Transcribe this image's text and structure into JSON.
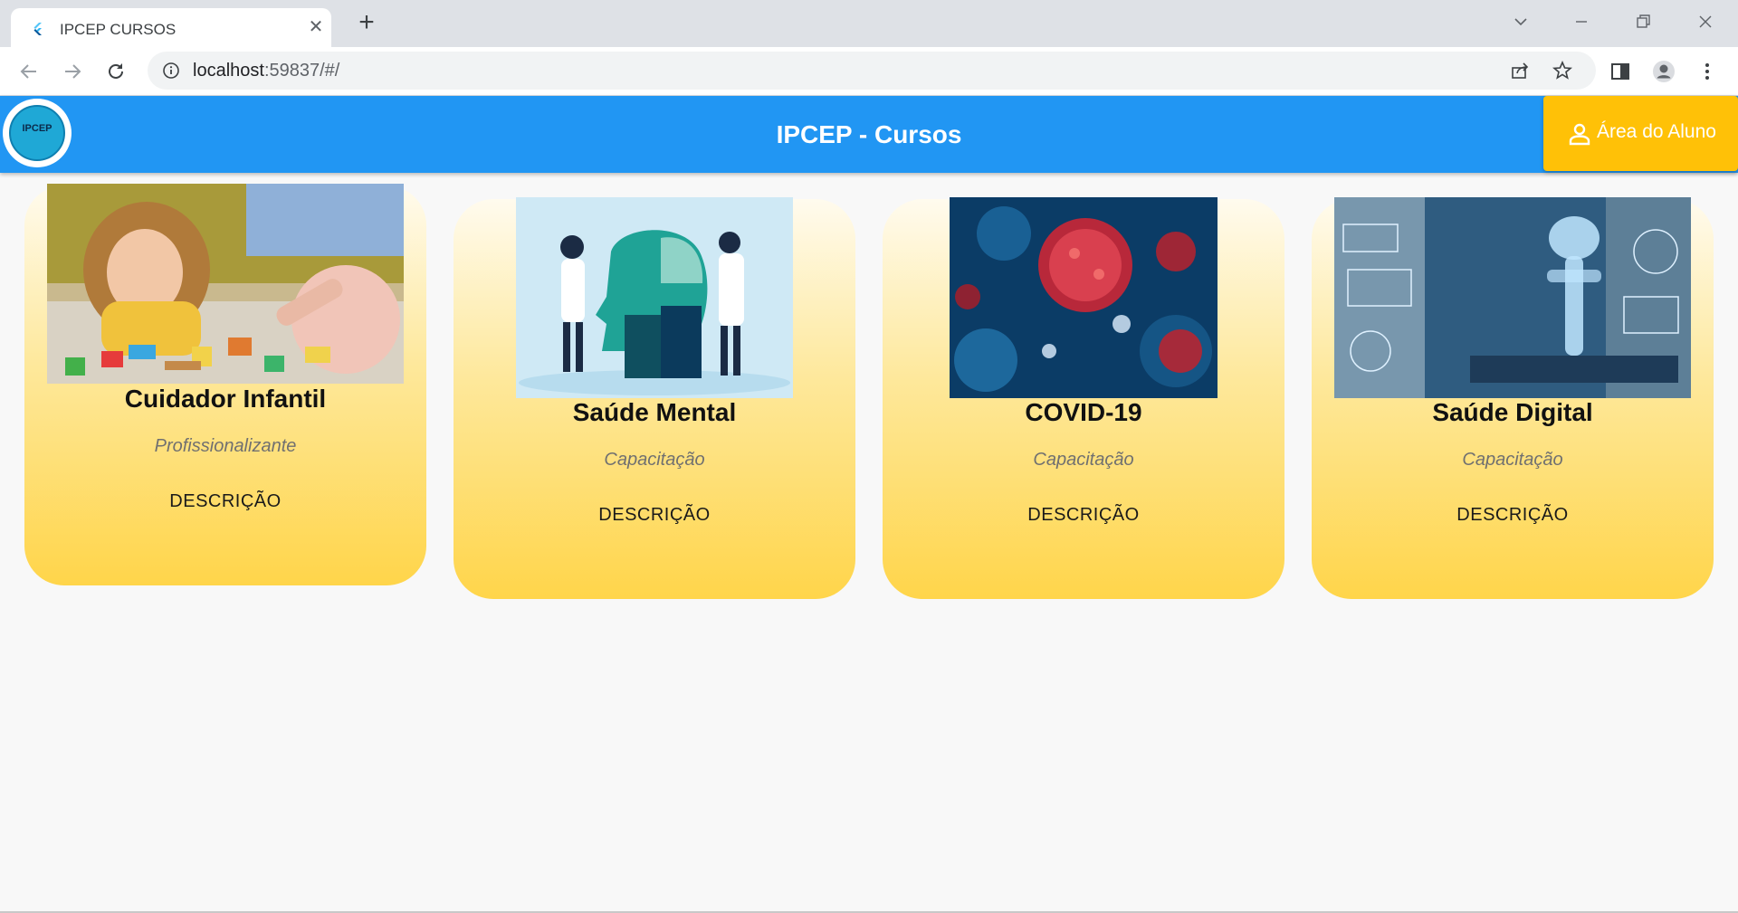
{
  "browser": {
    "tab_title": "IPCEP CURSOS",
    "url_host": "localhost",
    "url_rest": ":59837/#/",
    "favicon": "flutter-icon"
  },
  "appbar": {
    "title": "IPCEP - Cursos",
    "logo_text": "IPCEP",
    "aluno_button_label": "Área do Aluno",
    "color": "#2196f3",
    "button_color": "#ffc107"
  },
  "courses": [
    {
      "title": "Cuidador Infantil",
      "category": "Profissionalizante",
      "button": "DESCRIÇÃO",
      "image": "child-playing-blocks-photo"
    },
    {
      "title": "Saúde Mental",
      "category": "Capacitação",
      "button": "DESCRIÇÃO",
      "image": "mental-health-puzzle-illustration"
    },
    {
      "title": "COVID-19",
      "category": "Capacitação",
      "button": "DESCRIÇÃO",
      "image": "coronavirus-photo"
    },
    {
      "title": "Saúde Digital",
      "category": "Capacitação",
      "button": "DESCRIÇÃO",
      "image": "digital-health-photo"
    }
  ],
  "colors": {
    "card_gradient_top": "#fffbee",
    "card_gradient_bottom": "#ffd54a"
  }
}
